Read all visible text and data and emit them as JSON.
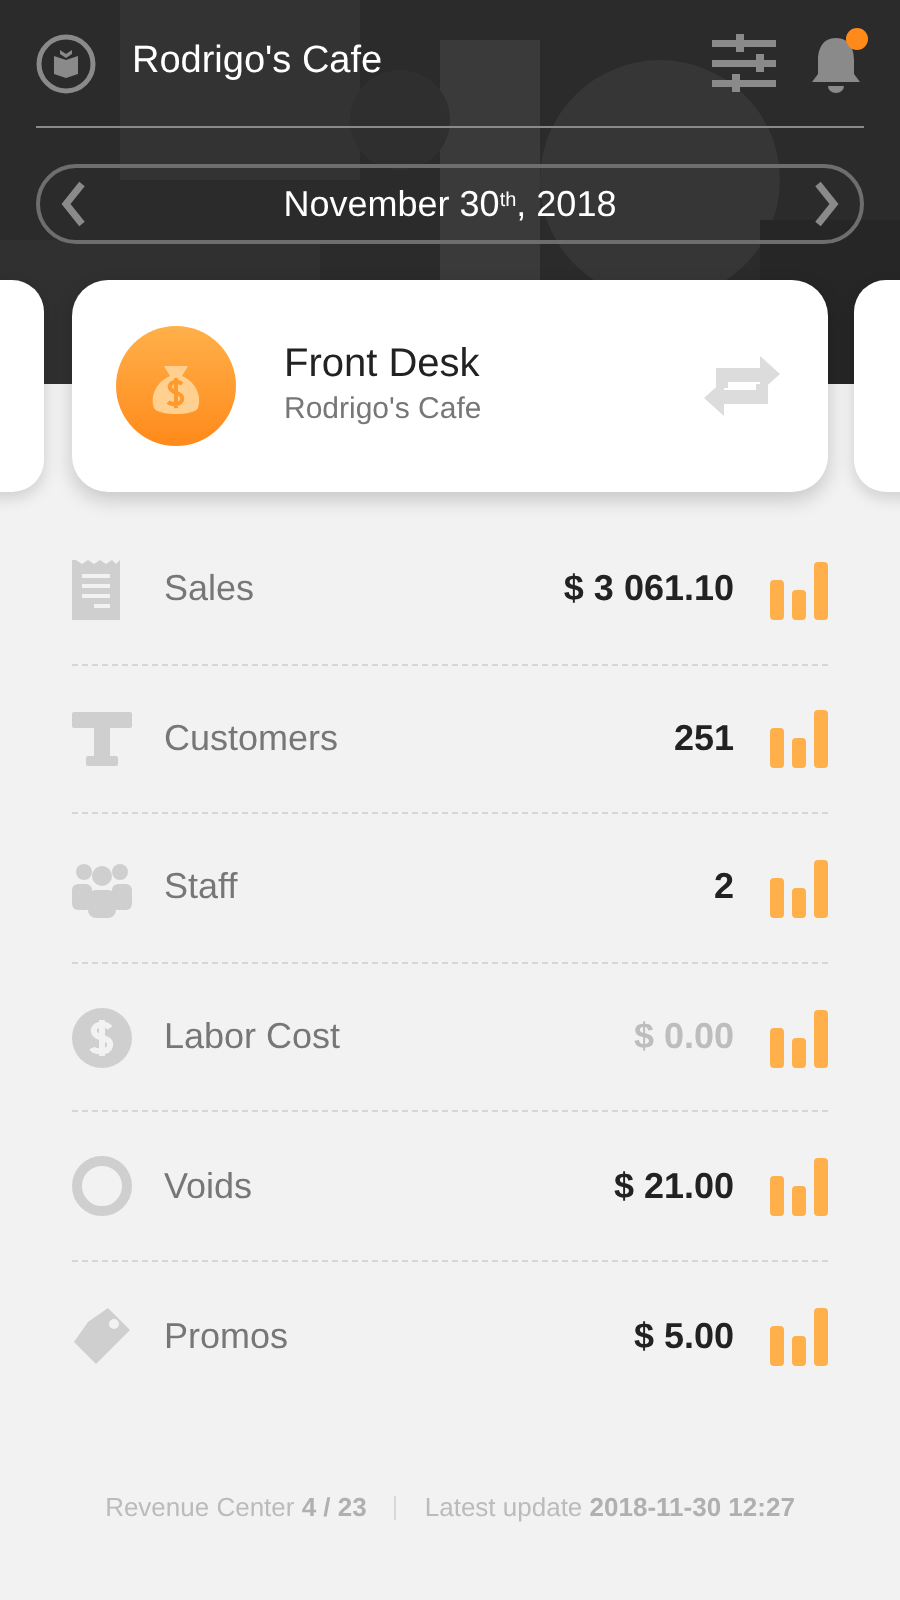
{
  "header": {
    "title": "Rodrigo's Cafe",
    "has_notification": true
  },
  "date_picker": {
    "label": "November 30$^{th}$, 2018"
  },
  "revenue_center": {
    "name": "Front Desk",
    "subtitle": "Rodrigo's Cafe"
  },
  "metrics": [
    {
      "kind": "receipt",
      "label": "Sales",
      "value": "$ 3 061.10",
      "dimmed": false
    },
    {
      "kind": "table",
      "label": "Customers",
      "value": "251",
      "dimmed": false
    },
    {
      "kind": "people",
      "label": "Staff",
      "value": "2",
      "dimmed": false
    },
    {
      "kind": "dollar",
      "label": "Labor Cost",
      "value": "$ 0.00",
      "dimmed": true
    },
    {
      "kind": "ring",
      "label": "Voids",
      "value": "$ 21.00",
      "dimmed": false
    },
    {
      "kind": "tag",
      "label": "Promos",
      "value": "$ 5.00",
      "dimmed": false
    }
  ],
  "footer": {
    "position": "Revenue Center **4 / 23**",
    "updated": "Latest update **2018-11-30 12:27**"
  }
}
